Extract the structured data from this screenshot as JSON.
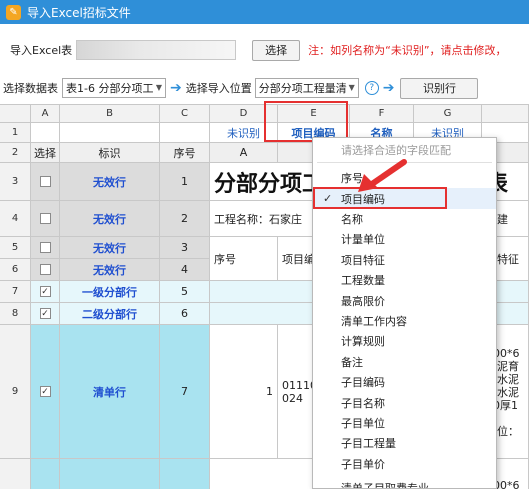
{
  "titlebar": {
    "icon": "excel-import-icon",
    "title": "导入Excel招标文件"
  },
  "toolbar": {
    "import_label": "导入Excel表",
    "browse_button": "选择",
    "hint": "注：如列名称为“未识别”，请点击修改，"
  },
  "options": {
    "select_sheet_label": "选择数据表",
    "sheet_value": "表1-6 分部分项工",
    "select_position_label": "选择导入位置",
    "position_value": "分部分项工程量清",
    "identify_button": "识别行"
  },
  "grid": {
    "col_letters": [
      "A",
      "B",
      "C",
      "D",
      "E",
      "F",
      "G"
    ],
    "field_row_num": "1",
    "field_labels": [
      "",
      "",
      "",
      "未识别",
      "项目编码",
      "名称",
      "未识别"
    ],
    "header_row_num": "2",
    "header_labels": [
      "选择",
      "标识",
      "序号",
      "A",
      "",
      "",
      ""
    ],
    "rows": [
      {
        "num": "3",
        "checked": false,
        "tag": "无效行",
        "seq": "1",
        "d": "分部分项工",
        "g": "表"
      },
      {
        "num": "4",
        "checked": false,
        "tag": "无效行",
        "seq": "2",
        "d": "工程名称：石家庄",
        "g": "公建"
      },
      {
        "num": "5",
        "checked": false,
        "tag": "无效行",
        "seq": "3",
        "d": "序号",
        "e": "项目编",
        "g": "目特征"
      },
      {
        "num": "6",
        "checked": false,
        "tag": "无效行",
        "seq": "4"
      },
      {
        "num": "7",
        "checked": true,
        "tag": "一级分部行",
        "seq": "5"
      },
      {
        "num": "8",
        "checked": true,
        "tag": "二级分部行",
        "seq": "6"
      },
      {
        "num": "9",
        "checked": true,
        "tag": "清单行",
        "seq": "7",
        "d": "1",
        "e": "01110\n024",
        "g": "600*6\n水泥育\n性水泥\n素水泥\n20厚1\n\n部位："
      },
      {
        "num": "10",
        "g": "600*6"
      }
    ]
  },
  "menu": {
    "placeholder": "请选择合适的字段匹配",
    "items": [
      "序号",
      "项目编码",
      "名称",
      "计量单位",
      "项目特征",
      "工程数量",
      "最高限价",
      "清单工作内容",
      "计算规则",
      "备注",
      "子目编码",
      "子目名称",
      "子目单位",
      "子目工程量",
      "子目单价",
      "清单子目取费专业"
    ],
    "selected_index": 1
  },
  "colors": {
    "titlebar": "#2f8fd8",
    "highlight": "#e53030",
    "link": "#1f4fd0",
    "hint": "#e02020"
  }
}
